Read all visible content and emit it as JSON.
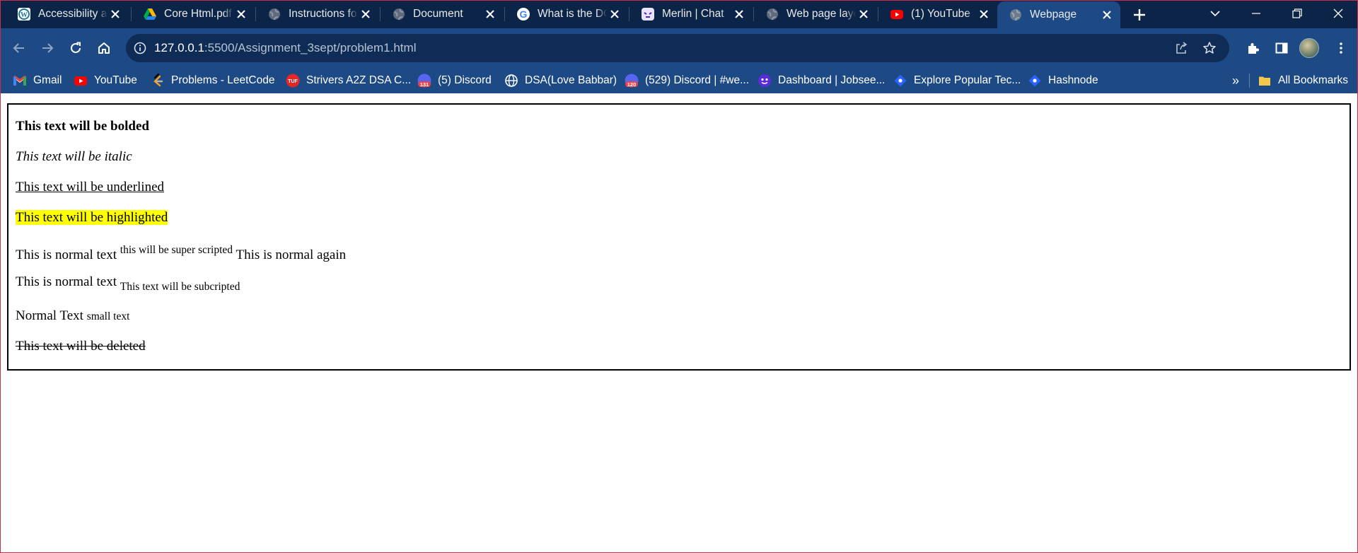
{
  "browser": {
    "tabs": [
      {
        "title": "Accessibility and",
        "icon": "wordpress-icon"
      },
      {
        "title": "Core Html.pdf",
        "icon": "google-drive-icon"
      },
      {
        "title": "Instructions for",
        "icon": "globe-icon"
      },
      {
        "title": "Document",
        "icon": "globe-icon"
      },
      {
        "title": "What is the DOM",
        "icon": "google-icon"
      },
      {
        "title": "Merlin | Chat",
        "icon": "merlin-icon"
      },
      {
        "title": "Web page layout",
        "icon": "globe-icon"
      },
      {
        "title": "(1) YouTube",
        "icon": "youtube-icon"
      },
      {
        "title": "Webpage",
        "icon": "globe-icon",
        "active": true
      }
    ],
    "address": {
      "host": "127.0.0.1",
      "path": ":5500/Assignment_3sept/problem1.html"
    },
    "bookmarks": [
      {
        "label": "Gmail",
        "icon": "gmail-icon"
      },
      {
        "label": "YouTube",
        "icon": "youtube-icon"
      },
      {
        "label": "Problems - LeetCode",
        "icon": "leetcode-icon"
      },
      {
        "label": "Strivers A2Z DSA C...",
        "icon": "tuf-icon"
      },
      {
        "label": "(5) Discord",
        "icon": "discord-icon",
        "badge": "131"
      },
      {
        "label": "DSA(Love Babbar)",
        "icon": "globe-icon"
      },
      {
        "label": "(529) Discord | #we...",
        "icon": "discord-icon",
        "badge": "120"
      },
      {
        "label": "Dashboard | Jobsee...",
        "icon": "jobseeker-icon"
      },
      {
        "label": "Explore Popular Tec...",
        "icon": "diamond-icon"
      },
      {
        "label": "Hashnode",
        "icon": "hashnode-icon"
      }
    ],
    "more_bookmarks": "»",
    "all_bookmarks": "All Bookmarks",
    "colors": {
      "tabstrip": "#0b2447",
      "toolbar": "#1d4a85",
      "omnibox": "#0e2c55",
      "window_border": "#c4314b"
    }
  },
  "page": {
    "bold": "This text will be bolded",
    "italic": "This text will be italic",
    "underline": "This text will be underlined",
    "highlight": "This text will be highlighted",
    "sup_normal": "This is normal text",
    "sup_text": "this will be super scripted",
    "sup_after": "This is normal again",
    "sub_normal": "This is normal text",
    "sub_text": "This text will be subcripted",
    "small_normal": "Normal Text",
    "small_text": "small text",
    "deleted": "This text will be deleted",
    "highlight_color": "#ffff00"
  }
}
